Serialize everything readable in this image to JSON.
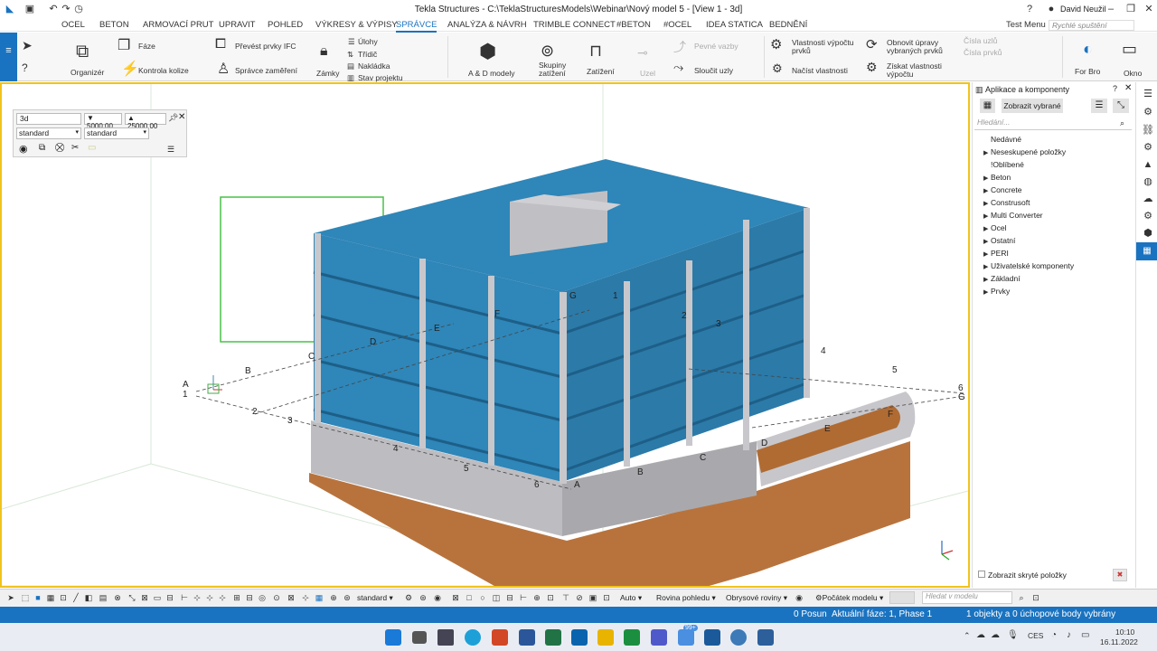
{
  "app": {
    "title": "Tekla Structures - C:\\TeklaStructuresModels\\Webinar\\Nový model 5 - [View 1 - 3d]",
    "user": "David Neužil",
    "search_placeholder": "Rychlé spuštění"
  },
  "menu": [
    "OCEL",
    "BETON",
    "ARMOVACÍ PRUT",
    "UPRAVIT",
    "POHLED",
    "VÝKRESY & VÝPISY",
    "SPRÁVCE",
    "ANALÝZA & NÁVRH",
    "TRIMBLE CONNECT",
    "#BETON",
    "#OCEL",
    "IDEA STATICA",
    "BEDNĚNÍ"
  ],
  "menu_right": "Test Menu",
  "ribbon": {
    "organizer": "Organizér",
    "faze": "Fáze",
    "kontrola_kolize": "Kontrola kolize",
    "prevest_ifc": "Převést prvky IFC",
    "spravce_zamereni": "Správce zaměření",
    "zamky": "Zámky",
    "ulohy": "Úlohy",
    "tridic": "Třídič",
    "nakladka": "Nakládka",
    "stav_projektu": "Stav projektu",
    "ad_modely": "A & D modely",
    "skupiny_zatizeni_1": "Skupiny",
    "skupiny_zatizeni_2": "zatížení",
    "zatizeni": "Zatížení",
    "uzel": "Uzel",
    "pevne_vazby": "Pevné vazby",
    "sloucit_uzly": "Sloučit uzly",
    "vlastnosti_vypoctu_1": "Vlastnosti výpočtu",
    "vlastnosti_vypoctu_2": "prvků",
    "nacist_vlastnosti": "Načíst vlastnosti",
    "obnovit_upravy_1": "Obnovit úpravy",
    "obnovit_upravy_2": "vybraných prvků",
    "ziskat_vlastnosti_1": "Získat vlastnosti",
    "ziskat_vlastnosti_2": "výpočtu",
    "cisla_uzlu": "Čísla uzlů",
    "cisla_prvku": "Čísla prvků",
    "for_bro": "For Bro",
    "okno": "Okno"
  },
  "view_panel": {
    "name": "3d",
    "bottom_value": "5000.00",
    "top_value": "25000.00",
    "filter1": "standard",
    "filter2": "standard"
  },
  "grid_labels": {
    "left": [
      "A",
      "B",
      "C",
      "D",
      "E",
      "F",
      "G"
    ],
    "numbers": [
      "1",
      "2",
      "3",
      "4",
      "5",
      "6"
    ],
    "right_numbers": [
      "1",
      "2",
      "3",
      "4",
      "5",
      "6"
    ],
    "right_letters": [
      "A",
      "B",
      "C",
      "D",
      "E",
      "F",
      "G"
    ]
  },
  "side_panel": {
    "title": "Aplikace a komponenty",
    "show_selected": "Zobrazit vybrané",
    "search_placeholder": "Hledání...",
    "items": [
      {
        "label": "Nedávné",
        "arrow": false
      },
      {
        "label": "Neseskupené položky",
        "arrow": true
      },
      {
        "label": "!Oblíbené",
        "arrow": false
      },
      {
        "label": "Beton",
        "arrow": true
      },
      {
        "label": "Concrete",
        "arrow": true
      },
      {
        "label": "Construsoft",
        "arrow": true
      },
      {
        "label": "Multi Converter",
        "arrow": true
      },
      {
        "label": "Ocel",
        "arrow": true
      },
      {
        "label": "Ostatní",
        "arrow": true
      },
      {
        "label": "PERI",
        "arrow": true
      },
      {
        "label": "Uživatelské komponenty",
        "arrow": true
      },
      {
        "label": "Základní",
        "arrow": true
      },
      {
        "label": "Prvky",
        "arrow": true
      }
    ],
    "show_hidden": "Zobrazit skryté položky"
  },
  "bottom_toolbar": {
    "filter": "standard",
    "auto": "Auto",
    "rovina_pohledu": "Rovina pohledu",
    "obrysove_roviny": "Obrysové roviny",
    "pocatek_modelu": "Počátek modelu",
    "search_placeholder": "Hledat v modelu"
  },
  "status": {
    "left": "0 Posun",
    "phase": "Aktuální fáze: 1, Phase 1",
    "selection": "1 objekty a 0 úchopové body vybrány"
  },
  "taskbar": {
    "lang": "CES",
    "time": "10:10",
    "date": "16.11.2022",
    "badge": "99+"
  },
  "colors": {
    "accent": "#1a73c0",
    "slab": "#2f86b8",
    "concrete": "#b9b9bd",
    "wood": "#b8733d",
    "viewport_border": "#f0c31c"
  }
}
